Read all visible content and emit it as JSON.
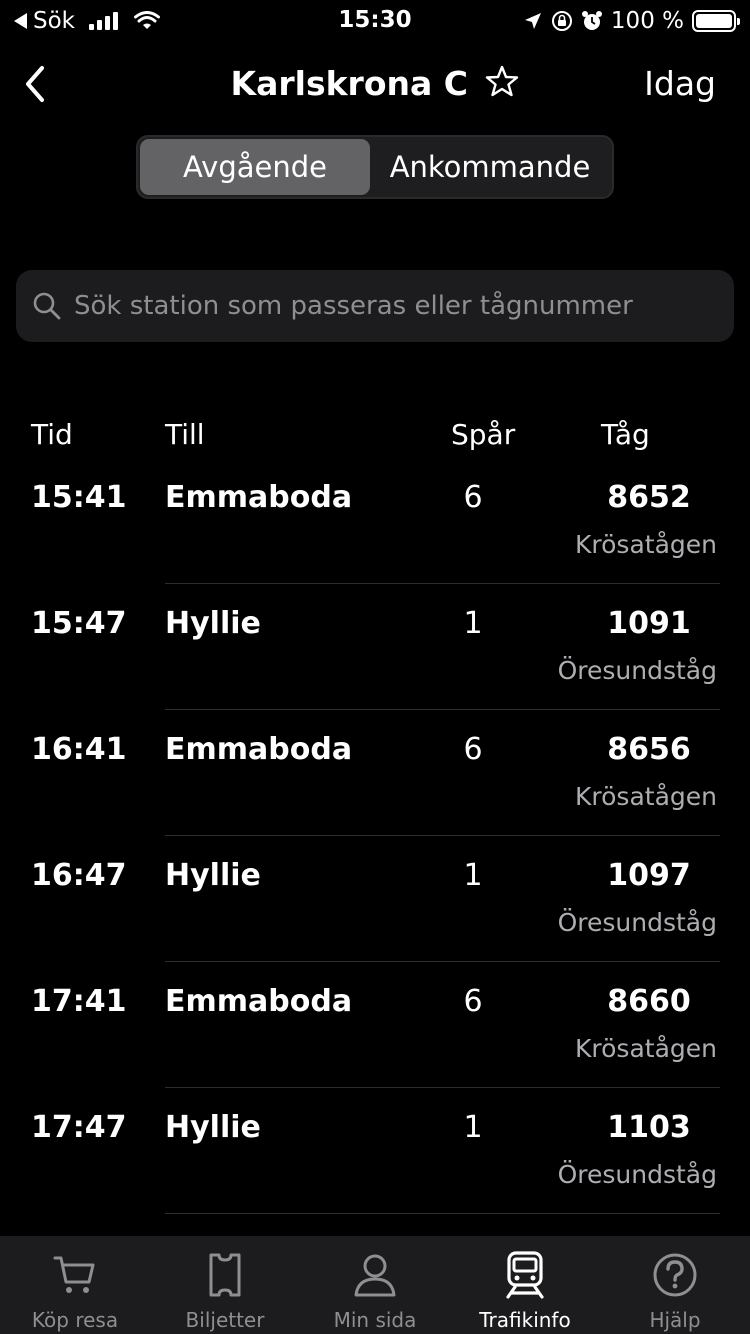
{
  "status_bar": {
    "carrier_back": "Sök",
    "time": "15:30",
    "battery": "100 %"
  },
  "nav": {
    "title": "Karlskrona C",
    "today": "Idag"
  },
  "segment": {
    "departing": "Avgående",
    "arriving": "Ankommande"
  },
  "search": {
    "placeholder": "Sök station som passeras eller tågnummer"
  },
  "table": {
    "headers": {
      "time": "Tid",
      "destination": "Till",
      "track": "Spår",
      "train": "Tåg"
    },
    "rows": [
      {
        "time": "15:41",
        "destination": "Emmaboda",
        "track": "6",
        "train_number": "8652",
        "operator": "Krösatågen"
      },
      {
        "time": "15:47",
        "destination": "Hyllie",
        "track": "1",
        "train_number": "1091",
        "operator": "Öresundståg"
      },
      {
        "time": "16:41",
        "destination": "Emmaboda",
        "track": "6",
        "train_number": "8656",
        "operator": "Krösatågen"
      },
      {
        "time": "16:47",
        "destination": "Hyllie",
        "track": "1",
        "train_number": "1097",
        "operator": "Öresundståg"
      },
      {
        "time": "17:41",
        "destination": "Emmaboda",
        "track": "6",
        "train_number": "8660",
        "operator": "Krösatågen"
      },
      {
        "time": "17:47",
        "destination": "Hyllie",
        "track": "1",
        "train_number": "1103",
        "operator": "Öresundståg"
      }
    ]
  },
  "tabbar": {
    "items": [
      {
        "label": "Köp resa",
        "icon": "cart-icon"
      },
      {
        "label": "Biljetter",
        "icon": "ticket-icon"
      },
      {
        "label": "Min sida",
        "icon": "person-icon"
      },
      {
        "label": "Trafikinfo",
        "icon": "train-icon"
      },
      {
        "label": "Hjälp",
        "icon": "help-icon"
      }
    ]
  }
}
